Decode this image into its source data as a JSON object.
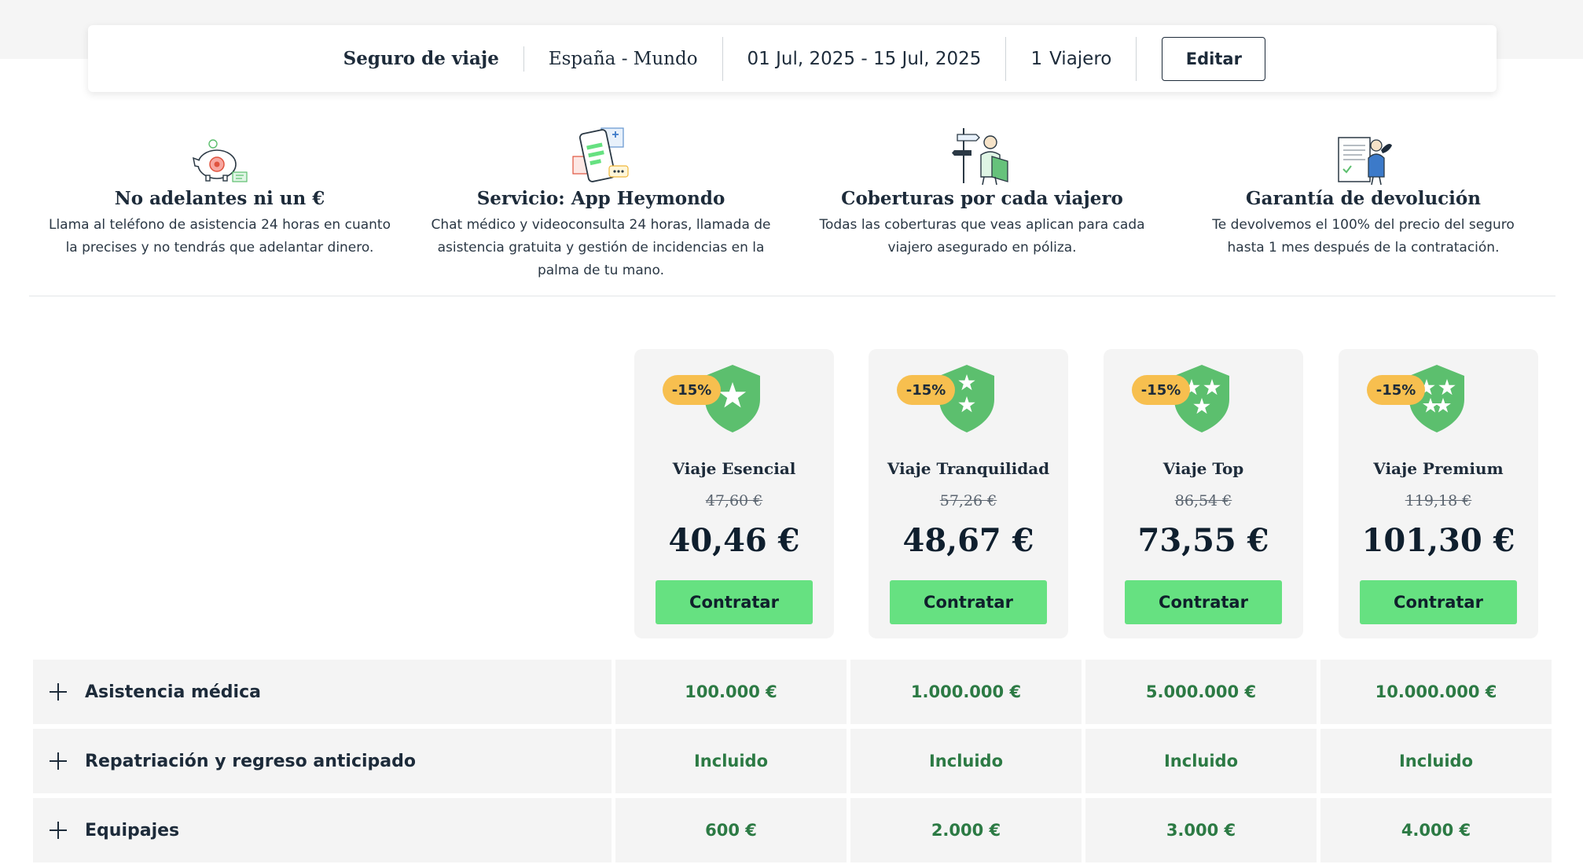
{
  "search_summary": {
    "title": "Seguro de viaje",
    "route": "España - Mundo",
    "dates": "01 Jul, 2025 - 15 Jul, 2025",
    "travelers_count": "1",
    "travelers_label": "Viajero",
    "edit_label": "Editar"
  },
  "benefits": [
    {
      "icon": "piggy-bank-icon",
      "title": "No adelantes ni un €",
      "text": "Llama al teléfono de asistencia 24 horas en cuanto la precises y no tendrás que adelantar dinero."
    },
    {
      "icon": "mobile-app-icon",
      "title": "Servicio: App Heymondo",
      "text": "Chat médico y videoconsulta 24 horas, llamada de asistencia gratuita y gestión de incidencias en la palma de tu mano."
    },
    {
      "icon": "traveler-icon",
      "title": "Coberturas por cada viajero",
      "text": "Todas las coberturas que veas aplican para cada viajero asegurado en póliza."
    },
    {
      "icon": "guarantee-document-icon",
      "title": "Garantía de devolución",
      "text": "Te devolvemos el 100% del precio del seguro hasta 1 mes después de la contratación."
    }
  ],
  "plans": [
    {
      "name": "Viaje Esencial",
      "badge": "-15%",
      "old_price": "47,60 €",
      "price": "40,46 €",
      "cta": "Contratar",
      "stars": 1
    },
    {
      "name": "Viaje Tranquilidad",
      "badge": "-15%",
      "old_price": "57,26 €",
      "price": "48,67 €",
      "cta": "Contratar",
      "stars": 2
    },
    {
      "name": "Viaje Top",
      "badge": "-15%",
      "old_price": "86,54 €",
      "price": "73,55 €",
      "cta": "Contratar",
      "stars": 3
    },
    {
      "name": "Viaje Premium",
      "badge": "-15%",
      "old_price": "119,18 €",
      "price": "101,30 €",
      "cta": "Contratar",
      "stars": 4
    }
  ],
  "coverages": [
    {
      "label": "Asistencia médica",
      "values": [
        "100.000 €",
        "1.000.000 €",
        "5.000.000 €",
        "10.000.000 €"
      ]
    },
    {
      "label": "Repatriación y regreso anticipado",
      "values": [
        "Incluido",
        "Incluido",
        "Incluido",
        "Incluido"
      ]
    },
    {
      "label": "Equipajes",
      "values": [
        "600 €",
        "2.000 €",
        "3.000 €",
        "4.000 €"
      ]
    }
  ],
  "colors": {
    "accent_green": "#66e181",
    "shield_green": "#5cbf6e",
    "value_green": "#2c7a44",
    "badge_yellow": "#f7bf4f",
    "text_dark": "#1d2b3a"
  }
}
